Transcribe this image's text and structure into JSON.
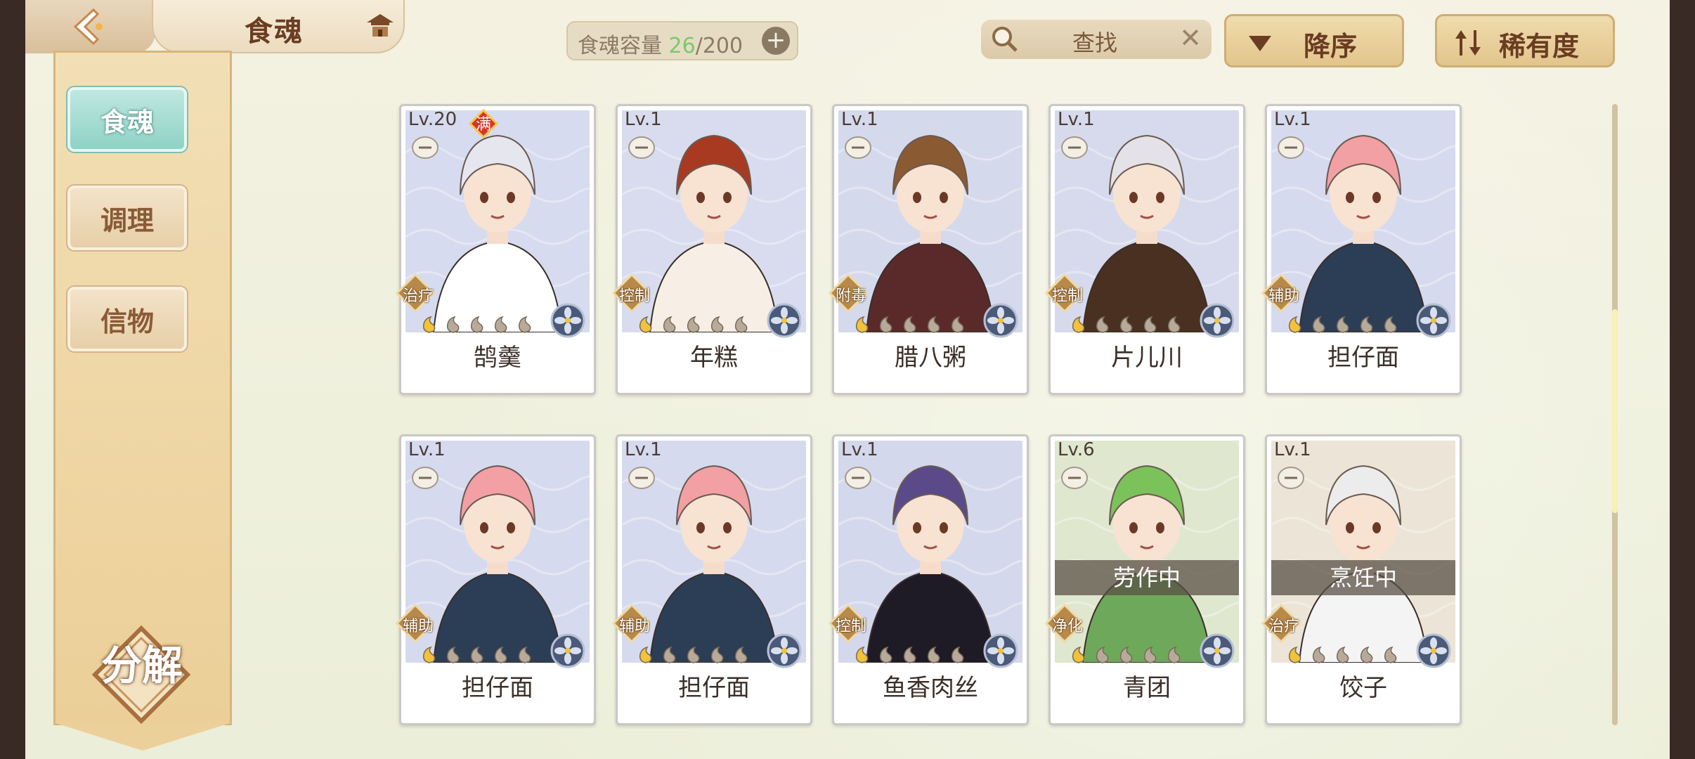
{
  "header": {
    "title": "食魂",
    "capacity_label": "食魂容量",
    "capacity_current": "26",
    "capacity_max": "/200",
    "search_placeholder": "查找",
    "sort_order_label": "降序",
    "sort_key_label": "稀有度"
  },
  "sidebar": {
    "items": [
      {
        "label": "食魂",
        "active": true
      },
      {
        "label": "调理",
        "active": false
      },
      {
        "label": "信物",
        "active": false
      }
    ],
    "decompose_label": "分解"
  },
  "cards": [
    {
      "level": "Lv.20",
      "max": "满",
      "role": "治疗",
      "name": "鹄羹",
      "stars": 1,
      "hair": "#e6e6ef",
      "outfit": "#ffffff",
      "bg": "#d6dbef",
      "status": ""
    },
    {
      "level": "Lv.1",
      "max": "",
      "role": "控制",
      "name": "年糕",
      "stars": 1,
      "hair": "#a83a22",
      "outfit": "#f7efe6",
      "bg": "#d8dcee",
      "status": ""
    },
    {
      "level": "Lv.1",
      "max": "",
      "role": "附毒",
      "name": "腊八粥",
      "stars": 1,
      "hair": "#8a5a32",
      "outfit": "#5a2a2a",
      "bg": "#d5d9ec",
      "status": ""
    },
    {
      "level": "Lv.1",
      "max": "",
      "role": "控制",
      "name": "片儿川",
      "stars": 1,
      "hair": "#e4e2e8",
      "outfit": "#4a3020",
      "bg": "#d6daec",
      "status": ""
    },
    {
      "level": "Lv.1",
      "max": "",
      "role": "辅助",
      "name": "担仔面",
      "stars": 1,
      "hair": "#f2a0a4",
      "outfit": "#2c3e56",
      "bg": "#d6daee",
      "status": ""
    },
    {
      "level": "Lv.1",
      "max": "",
      "role": "辅助",
      "name": "担仔面",
      "stars": 1,
      "hair": "#f2a0a4",
      "outfit": "#2c3e56",
      "bg": "#d6daee",
      "status": ""
    },
    {
      "level": "Lv.1",
      "max": "",
      "role": "辅助",
      "name": "担仔面",
      "stars": 1,
      "hair": "#f2a0a4",
      "outfit": "#2c3e56",
      "bg": "#d6daee",
      "status": ""
    },
    {
      "level": "Lv.1",
      "max": "",
      "role": "控制",
      "name": "鱼香肉丝",
      "stars": 1,
      "hair": "#5a4a8a",
      "outfit": "#1e1a26",
      "bg": "#d4d8ec",
      "status": ""
    },
    {
      "level": "Lv.6",
      "max": "",
      "role": "净化",
      "name": "青团",
      "stars": 1,
      "hair": "#7cc25a",
      "outfit": "#6ea85a",
      "bg": "#dfe7cf",
      "status": "劳作中"
    },
    {
      "level": "Lv.1",
      "max": "",
      "role": "治疗",
      "name": "饺子",
      "stars": 1,
      "hair": "#ececec",
      "outfit": "#f4f4f4",
      "bg": "#ece4d6",
      "status": "烹饪中"
    }
  ],
  "colors": {
    "accent_teal": "#8fd2c6",
    "panel_gold": "#eccf98",
    "text_brown": "#6a3d22"
  }
}
